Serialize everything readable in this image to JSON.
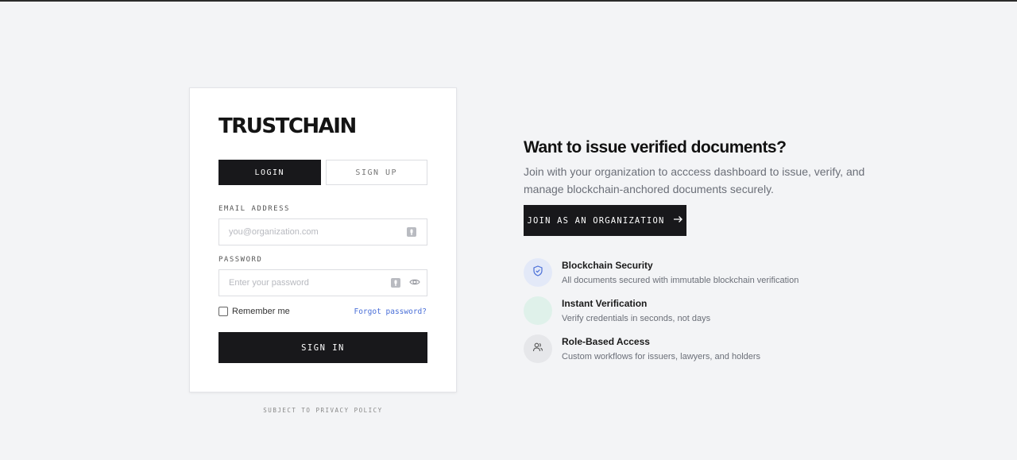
{
  "brand": {
    "logo_text": "TRUSTCHAIN"
  },
  "tabs": [
    {
      "label": "LOGIN",
      "active": true
    },
    {
      "label": "SIGN UP",
      "active": false
    }
  ],
  "form": {
    "email_label": "EMAIL ADDRESS",
    "email_placeholder": "you@organization.com",
    "email_value": "",
    "password_label": "PASSWORD",
    "password_placeholder": "Enter your password",
    "password_value": "",
    "remember_label": "Remember me",
    "remember_checked": false,
    "forgot_label": "Forgot password?",
    "submit_label": "SIGN IN"
  },
  "footer": {
    "privacy": "SUBJECT TO PRIVACY POLICY"
  },
  "promo": {
    "headline": "Want to issue verified documents?",
    "subtext": "Join with your organization to acccess dashboard to issue, verify, and manage blockchain-anchored documents securely.",
    "cta_label": "JOIN AS AN ORGANIZATION"
  },
  "features": [
    {
      "title": "Blockchain Security",
      "desc": "All documents secured with immutable blockchain verification",
      "icon": "shield-check-icon",
      "color": "#e3e9f8"
    },
    {
      "title": "Instant Verification",
      "desc": "Verify credentials in seconds, not days",
      "icon": "none",
      "color": "#dff1ea"
    },
    {
      "title": "Role-Based Access",
      "desc": "Custom workflows for issuers, lawyers, and holders",
      "icon": "users-icon",
      "color": "#e6e7ea"
    }
  ],
  "colors": {
    "background": "#f3f4f6",
    "primary": "#18181b",
    "link": "#4a6fd8"
  }
}
